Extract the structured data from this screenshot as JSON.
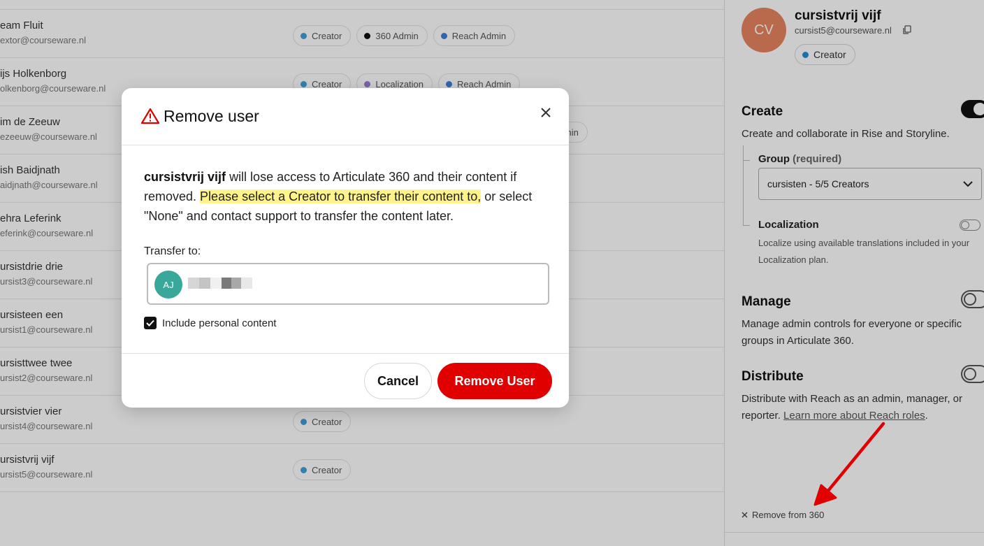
{
  "users": [
    {
      "name": "eam Fluit",
      "email": "extor@courseware.nl",
      "roles": [
        {
          "label": "Creator",
          "color": "#3da1dc"
        },
        {
          "label": "360 Admin",
          "color": "#111111"
        },
        {
          "label": "Reach Admin",
          "color": "#3d7fdc"
        }
      ]
    },
    {
      "name": "ijs Holkenborg",
      "email": "olkenborg@courseware.nl",
      "roles": [
        {
          "label": "Creator",
          "color": "#3da1dc"
        },
        {
          "label": "Localization",
          "color": "#9a7ad8"
        },
        {
          "label": "Reach Admin",
          "color": "#3d7fdc"
        }
      ]
    },
    {
      "name": "im de Zeeuw",
      "email": "ezeeuw@courseware.nl",
      "roles": [
        {
          "label": "Admin",
          "color": ""
        }
      ]
    },
    {
      "name": "ish Baidjnath",
      "email": "aidjnath@courseware.nl",
      "roles": []
    },
    {
      "name": "ehra Leferink",
      "email": "eferink@courseware.nl",
      "roles": []
    },
    {
      "name": "ursistdrie drie",
      "email": "ursist3@courseware.nl",
      "roles": []
    },
    {
      "name": "ursisteen een",
      "email": "ursist1@courseware.nl",
      "roles": []
    },
    {
      "name": "ursisttwee twee",
      "email": "ursist2@courseware.nl",
      "roles": []
    },
    {
      "name": "ursistvier vier",
      "email": "ursist4@courseware.nl",
      "roles": [
        {
          "label": "Creator",
          "color": "#3da1dc"
        }
      ]
    },
    {
      "name": "ursistvrij vijf",
      "email": "ursist5@courseware.nl",
      "roles": [
        {
          "label": "Creator",
          "color": "#3da1dc"
        }
      ]
    }
  ],
  "panel": {
    "initials": "CV",
    "name": "cursistvrij vijf",
    "email": "cursist5@courseware.nl",
    "role": "Creator",
    "create": {
      "title": "Create",
      "desc": "Create and collaborate in Rise and Storyline.",
      "enabled": true
    },
    "group": {
      "label": "Group",
      "required": "(required)",
      "value": "cursisten - 5/5 Creators"
    },
    "localization": {
      "title": "Localization",
      "desc": "Localize using available translations included in your Localization plan.",
      "enabled": false
    },
    "manage": {
      "title": "Manage",
      "desc": "Manage admin controls for everyone or specific groups in Articulate 360.",
      "enabled": false
    },
    "distribute": {
      "title": "Distribute",
      "desc_prefix": "Distribute with Reach as an admin, manager, or reporter.",
      "link": "Learn more about Reach roles",
      "desc_suffix": ".",
      "enabled": false
    },
    "remove": "Remove from 360"
  },
  "modal": {
    "title": "Remove user",
    "user_name": "cursistvrij vijf",
    "text_1": " will lose access to Articulate 360 and their content if removed. ",
    "highlight": "Please select a Creator to transfer their content to,",
    "text_2": " or select \"None\" and contact support to transfer the content later.",
    "transfer_label": "Transfer to:",
    "transfer_initials": "AJ",
    "include_label": "Include personal content",
    "include_checked": true,
    "cancel": "Cancel",
    "confirm": "Remove User"
  },
  "colors": {
    "danger": "#e00000",
    "avatar_panel": "#e8845f",
    "avatar_transfer": "#3aa79b",
    "highlight": "#fff48c",
    "creator_dot": "#3da1dc"
  }
}
